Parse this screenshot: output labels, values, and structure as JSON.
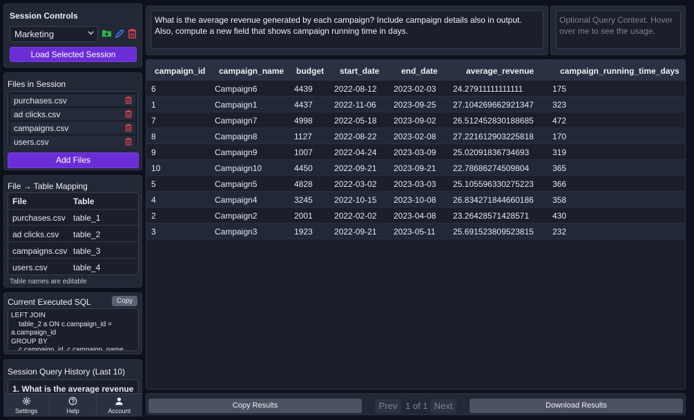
{
  "session": {
    "title": "Session Controls",
    "selected": "Marketing",
    "load_label": "Load Selected Session"
  },
  "files": {
    "title": "Files in Session",
    "items": [
      "purchases.csv",
      "ad clicks.csv",
      "campaigns.csv",
      "users.csv"
    ],
    "add_label": "Add Files"
  },
  "mapping": {
    "title": "File → Table Mapping",
    "headers": [
      "File",
      "Table"
    ],
    "rows": [
      {
        "file": "purchases.csv",
        "table": "table_1"
      },
      {
        "file": "ad clicks.csv",
        "table": "table_2"
      },
      {
        "file": "campaigns.csv",
        "table": "table_3"
      },
      {
        "file": "users.csv",
        "table": "table_4"
      }
    ],
    "note": "Table names are editable"
  },
  "sql": {
    "title": "Current Executed SQL",
    "copy_label": "Copy",
    "text": "LEFT JOIN\n    table_2 a ON c.campaign_id =\na.campaign_id\nGROUP BY\n    c.campaign_id, c.campaign_name,"
  },
  "history": {
    "title": "Session Query History (Last 10)",
    "first": "1. What is the average revenue"
  },
  "nav": {
    "settings": "Settings",
    "help": "Help",
    "account": "Account"
  },
  "query": {
    "text": "What is the average revenue generated by each campaign? Include campaign details also in output. Also, compute a new field that shows campaign running time in days.",
    "context_placeholder": "Optional Query Context. Hover over me to see the usage."
  },
  "results": {
    "headers": [
      "campaign_id",
      "campaign_name",
      "budget",
      "start_date",
      "end_date",
      "average_revenue",
      "campaign_running_time_days"
    ],
    "rows": [
      [
        "6",
        "Campaign6",
        "4439",
        "2022-08-12",
        "2023-02-03",
        "24.27911111111111",
        "175"
      ],
      [
        "1",
        "Campaign1",
        "4437",
        "2022-11-06",
        "2023-09-25",
        "27.104269662921347",
        "323"
      ],
      [
        "7",
        "Campaign7",
        "4998",
        "2022-05-18",
        "2023-09-02",
        "26.512452830188685",
        "472"
      ],
      [
        "8",
        "Campaign8",
        "1127",
        "2022-08-22",
        "2023-02-08",
        "27.221612903225818",
        "170"
      ],
      [
        "9",
        "Campaign9",
        "1007",
        "2022-04-24",
        "2023-03-09",
        "25.02091836734693",
        "319"
      ],
      [
        "10",
        "Campaign10",
        "4450",
        "2022-09-21",
        "2023-09-21",
        "22.78686274509804",
        "365"
      ],
      [
        "5",
        "Campaign5",
        "4828",
        "2022-03-02",
        "2023-03-03",
        "25.105596330275223",
        "366"
      ],
      [
        "4",
        "Campaign4",
        "3245",
        "2022-10-15",
        "2023-10-08",
        "26.834271844660186",
        "358"
      ],
      [
        "2",
        "Campaign2",
        "2001",
        "2022-02-02",
        "2023-04-08",
        "23.26428571428571",
        "430"
      ],
      [
        "3",
        "Campaign3",
        "1923",
        "2022-09-21",
        "2023-05-11",
        "25.691523809523815",
        "232"
      ]
    ]
  },
  "footer": {
    "copy_label": "Copy Results",
    "prev_label": "Prev",
    "page_label": "1 of 1",
    "next_label": "Next",
    "download_label": "Download Results"
  },
  "colors": {
    "accent": "#6b2ed6",
    "trash": "#e0474c",
    "add_folder": "#2fb34a",
    "edit": "#3b82f6"
  }
}
